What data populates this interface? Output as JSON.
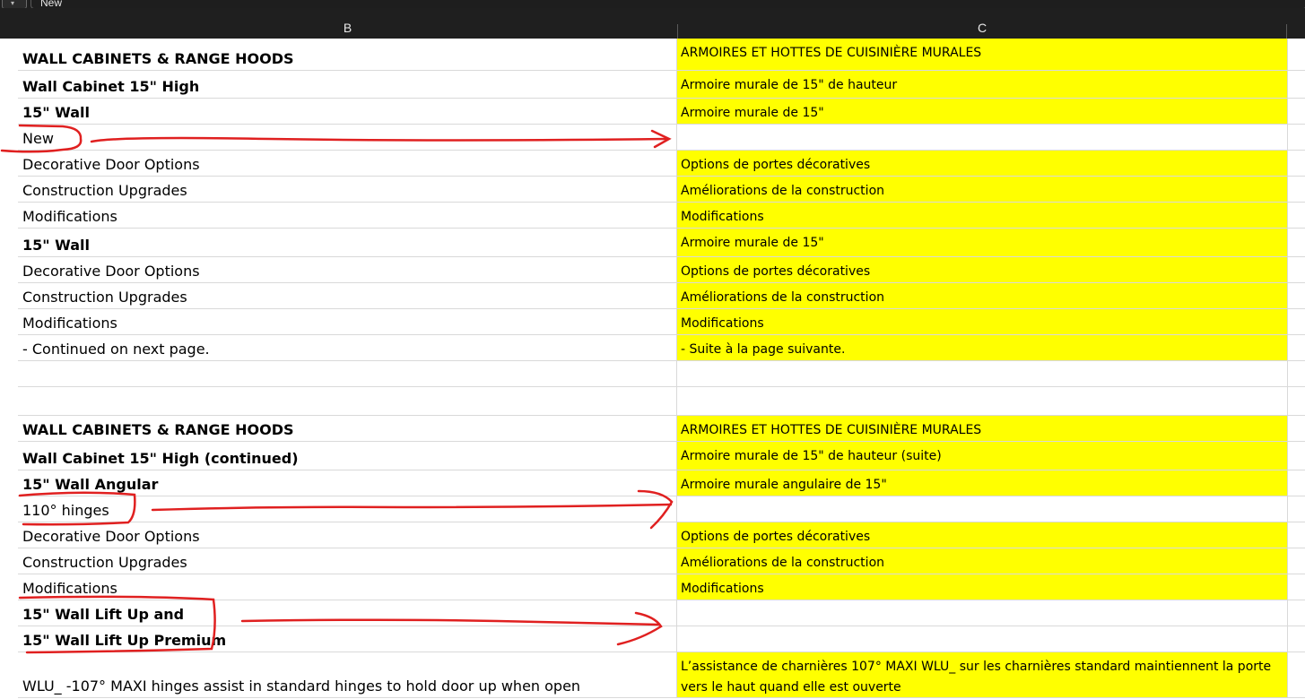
{
  "formula_bar": {
    "value": "New"
  },
  "column_headers": {
    "b": "B",
    "c": "C"
  },
  "rows": [
    {
      "b": "WALL CABINETS & RANGE HOODS",
      "b_bold": true,
      "c": "ARMOIRES ET HOTTES DE CUISINIÈRE MURALES",
      "c_highlight": true
    },
    {
      "b": "Wall Cabinet 15\" High",
      "b_bold": true,
      "c": "Armoire murale de 15\" de hauteur",
      "c_highlight": true
    },
    {
      "b": "15\" Wall",
      "b_bold": true,
      "c": "Armoire murale de 15\"",
      "c_highlight": true
    },
    {
      "b": "New",
      "b_bold": false,
      "c": "",
      "c_highlight": false
    },
    {
      "b": "Decorative Door Options",
      "b_bold": false,
      "c": "Options de portes décoratives",
      "c_highlight": true
    },
    {
      "b": "Construction Upgrades",
      "b_bold": false,
      "c": "Améliorations de la construction",
      "c_highlight": true
    },
    {
      "b": "Modifications",
      "b_bold": false,
      "c": "Modifications",
      "c_highlight": true
    },
    {
      "b": "15\" Wall",
      "b_bold": true,
      "c": "Armoire murale de 15\"",
      "c_highlight": true
    },
    {
      "b": "Decorative Door Options",
      "b_bold": false,
      "c": "Options de portes décoratives",
      "c_highlight": true
    },
    {
      "b": "Construction Upgrades",
      "b_bold": false,
      "c": "Améliorations de la construction",
      "c_highlight": true
    },
    {
      "b": "Modifications",
      "b_bold": false,
      "c": "Modifications",
      "c_highlight": true
    },
    {
      "b": " - Continued on next page.",
      "b_bold": false,
      "c": " - Suite à la page suivante.",
      "c_highlight": true
    },
    {
      "b": "",
      "b_bold": false,
      "c": "",
      "c_highlight": false
    },
    {
      "b": "",
      "b_bold": false,
      "c": "",
      "c_highlight": false
    },
    {
      "b": "WALL CABINETS & RANGE HOODS",
      "b_bold": true,
      "c": "ARMOIRES ET HOTTES DE CUISINIÈRE MURALES",
      "c_highlight": true
    },
    {
      "b": "Wall Cabinet 15\" High (continued)",
      "b_bold": true,
      "c": "Armoire murale de 15\" de hauteur (suite)",
      "c_highlight": true
    },
    {
      "b": "15\" Wall Angular",
      "b_bold": true,
      "c": "Armoire murale angulaire de 15\"",
      "c_highlight": true
    },
    {
      "b": "110° hinges",
      "b_bold": false,
      "c": "",
      "c_highlight": false
    },
    {
      "b": "Decorative Door Options",
      "b_bold": false,
      "c": "Options de portes décoratives",
      "c_highlight": true
    },
    {
      "b": "Construction Upgrades",
      "b_bold": false,
      "c": "Améliorations de la construction",
      "c_highlight": true
    },
    {
      "b": "Modifications",
      "b_bold": false,
      "c": "Modifications",
      "c_highlight": true
    },
    {
      "b": "15\" Wall Lift Up and",
      "b_bold": true,
      "c": "",
      "c_highlight": false
    },
    {
      "b": "15\" Wall Lift Up Premium",
      "b_bold": true,
      "c": "",
      "c_highlight": false
    },
    {
      "b": "WLU_ -107° MAXI hinges assist in standard hinges to hold door up when open",
      "b_bold": false,
      "c": "L’assistance de charnières 107° MAXI WLU_ sur les charnières standard maintiennent la porte vers le haut quand elle est ouverte",
      "c_highlight": true
    }
  ],
  "colors": {
    "highlight": "#ffff00",
    "annotation": "#e02020",
    "header_bg": "#1f1f1f"
  }
}
